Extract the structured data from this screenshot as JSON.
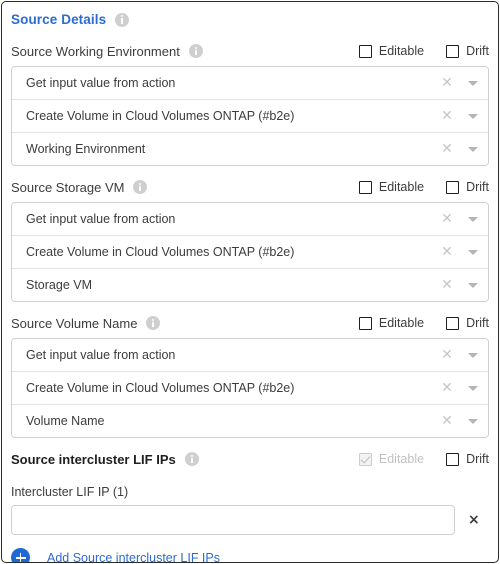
{
  "card": {
    "title": "Source Details",
    "title_color": "#2c6bd1",
    "info_icon": "info-icon"
  },
  "checkbox_labels": {
    "editable": "Editable",
    "drift": "Drift"
  },
  "fields": [
    {
      "label": "Source Working Environment",
      "bold": false,
      "editable_checked": false,
      "editable_disabled": false,
      "drift_checked": false,
      "rows": [
        "Get input value from action",
        "Create Volume in Cloud Volumes ONTAP (#b2e)",
        "Working Environment"
      ]
    },
    {
      "label": "Source Storage VM",
      "bold": false,
      "editable_checked": false,
      "editable_disabled": false,
      "drift_checked": false,
      "rows": [
        "Get input value from action",
        "Create Volume in Cloud Volumes ONTAP (#b2e)",
        "Storage VM"
      ]
    },
    {
      "label": "Source Volume Name",
      "bold": false,
      "editable_checked": false,
      "editable_disabled": false,
      "drift_checked": false,
      "rows": [
        "Get input value from action",
        "Create Volume in Cloud Volumes ONTAP (#b2e)",
        "Volume Name"
      ]
    }
  ],
  "lif_section": {
    "label": "Source intercluster LIF IPs",
    "editable_checked": true,
    "editable_disabled": true,
    "drift_checked": false,
    "sub_label": "Intercluster LIF IP (1)",
    "input_value": "",
    "input_placeholder": "",
    "remove_glyph": "×",
    "add_label": "Add Source intercluster LIF IPs"
  },
  "glyphs": {
    "clear": "✕"
  },
  "colors": {
    "accent": "#2c6bd1",
    "plus_button": "#1e69d2",
    "border": "#cfcfcf",
    "card_border": "#2b2b2b"
  }
}
